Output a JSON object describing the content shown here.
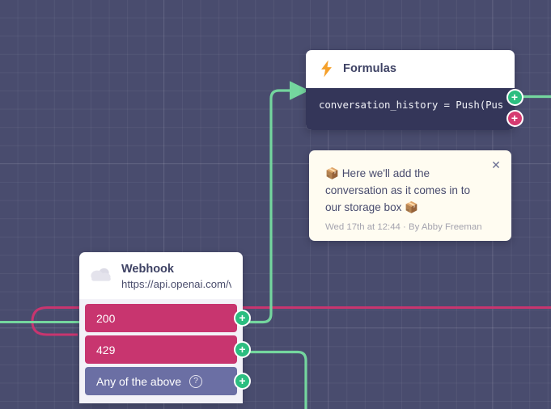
{
  "canvas": {
    "background_color": "#494C6E",
    "grid_color": "#5A5C7C"
  },
  "palette": {
    "green": "#2CBE80",
    "green_edge": "#74D69E",
    "pink": "#C8356F",
    "pink_edge": "#D63B71",
    "purple_row": "#6B6FA4",
    "node_dark": "#343659",
    "note_bg": "#FFFCF1",
    "orange": "#F5A02A"
  },
  "nodes": {
    "formulas": {
      "icon": "lightning-bolt-icon",
      "title": "Formulas",
      "code": "conversation_history = Push(Pus",
      "handles": [
        {
          "name": "add-success-branch",
          "type": "plus",
          "color": "green",
          "symbol": "+"
        },
        {
          "name": "add-error-branch",
          "type": "plus",
          "color": "pink",
          "symbol": "+"
        }
      ]
    },
    "webhook": {
      "icon": "cloud-icon",
      "title": "Webhook",
      "url": "https://api.openai.com/v",
      "rows": [
        {
          "label": "200",
          "kind": "status",
          "help": false,
          "handle": {
            "name": "add-branch-200",
            "color": "green",
            "symbol": "+"
          }
        },
        {
          "label": "429",
          "kind": "status",
          "help": false,
          "handle": {
            "name": "add-branch-429",
            "color": "green",
            "symbol": "+"
          }
        },
        {
          "label": "Any of the above",
          "kind": "anyof",
          "help": true,
          "help_symbol": "?",
          "handle": {
            "name": "add-branch-any",
            "color": "green",
            "symbol": "+"
          }
        }
      ]
    }
  },
  "note": {
    "text": "📦 Here we'll add the conversation as it comes in to our storage box 📦",
    "meta": "Wed 17th at 12:44 · By Abby Freeman",
    "close_symbol": "✕"
  }
}
